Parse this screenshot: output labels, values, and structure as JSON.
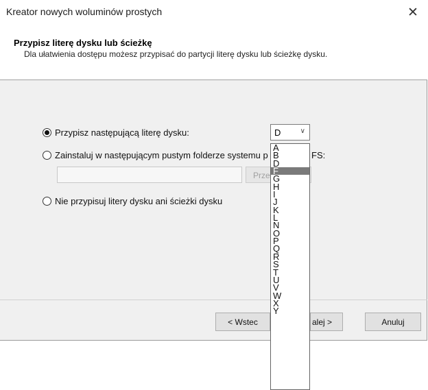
{
  "window": {
    "title": "Kreator nowych woluminów prostych",
    "close_glyph": "✕"
  },
  "header": {
    "title": "Przypisz literę dysku lub ścieżkę",
    "description": "Dla ułatwienia dostępu możesz przypisać do partycji literę dysku lub ścieżkę dysku."
  },
  "options": {
    "assign_letter": "Przypisz następującą literę dysku:",
    "mount_folder_visible": "Zainstaluj w następującym pustym folderze systemu p",
    "mount_folder_tail": "FS:",
    "no_assign": "Nie przypisuj litery dysku ani ścieżki dysku",
    "selected": "assign_letter"
  },
  "drive_combo": {
    "value": "D",
    "arrow_icon": "chevron-down-icon"
  },
  "path_input": {
    "value": ""
  },
  "browse_button": {
    "label_visible": "Prze"
  },
  "buttons": {
    "back": "< Wstec",
    "next_visible": "alej >",
    "cancel": "Anuluj"
  },
  "dropdown": {
    "items": [
      "A",
      "B",
      "D",
      "F",
      "G",
      "H",
      "I",
      "J",
      "K",
      "L",
      "N",
      "O",
      "P",
      "Q",
      "R",
      "S",
      "T",
      "U",
      "V",
      "W",
      "X",
      "Y"
    ],
    "selected": "F"
  }
}
